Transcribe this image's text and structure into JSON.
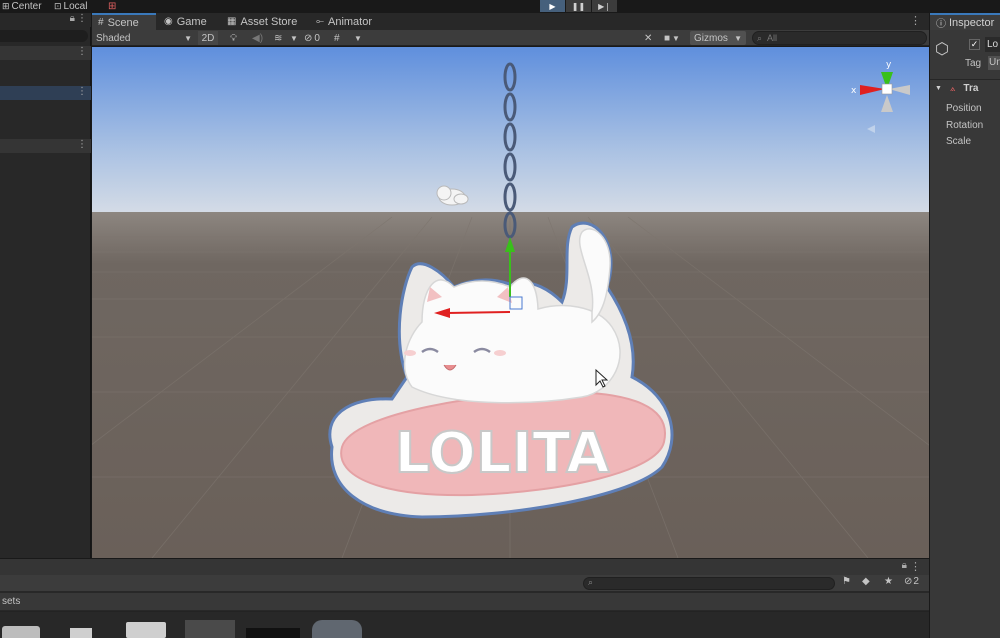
{
  "toolbar": {
    "pivot_label": "Center",
    "space_label": "Local"
  },
  "scene_tabs": [
    "Scene",
    "Game",
    "Asset Store",
    "Animator"
  ],
  "scene_toolbar": {
    "draw_mode": "Shaded",
    "mode_2d": "2D",
    "hidden_count": "0",
    "gizmos_label": "Gizmos",
    "search_placeholder": "All"
  },
  "viewport": {
    "logo_text": "LOLITA",
    "axis_y": "y",
    "axis_x": "x"
  },
  "inspector": {
    "title": "Inspector",
    "object_name": "Lo",
    "tag_label": "Tag",
    "tag_value": "Un",
    "component_title": "Tra",
    "fields": [
      "Position",
      "Rotation",
      "Scale"
    ]
  },
  "project": {
    "breadcrumb": "sets",
    "hidden_count": "2"
  },
  "colors": {
    "accent": "#3a79bb",
    "sky_top": "#5f8fdd",
    "ground": "#6b625c",
    "gizmo_x": "#e02020",
    "gizmo_y": "#39c01a"
  }
}
